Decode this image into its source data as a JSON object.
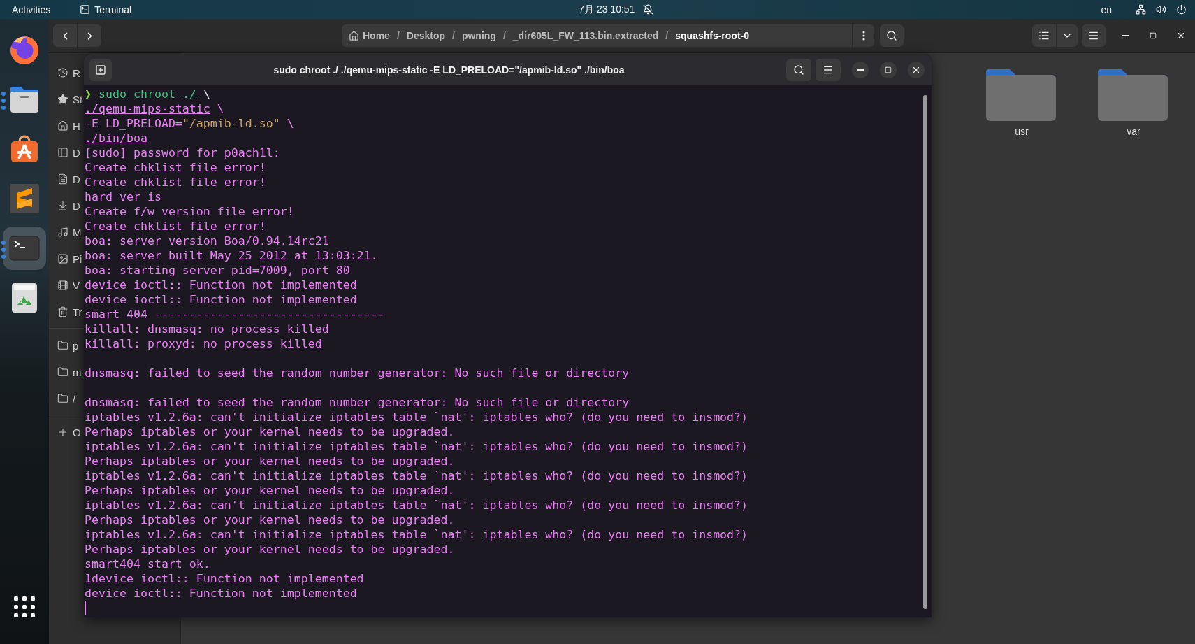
{
  "top_bar": {
    "activities": "Activities",
    "app_menu": "Terminal",
    "clock": "7月 23  10:51",
    "language": "en"
  },
  "dock": [
    {
      "kind": "browser",
      "running": false,
      "active": false
    },
    {
      "kind": "files",
      "running": true,
      "active": false
    },
    {
      "kind": "store",
      "running": false,
      "active": false
    },
    {
      "kind": "editor",
      "running": false,
      "active": false
    },
    {
      "kind": "terminal",
      "running": true,
      "active": true
    },
    {
      "kind": "trash",
      "running": false,
      "active": false
    },
    {
      "kind": "apps",
      "running": false,
      "active": false
    }
  ],
  "files_window": {
    "path_bar": [
      {
        "label": "Home",
        "kind": "home",
        "selected": false
      },
      {
        "label": "Desktop",
        "separator": "/",
        "selected": false
      },
      {
        "label": "pwning",
        "separator": "/",
        "selected": false
      },
      {
        "label": "_dir605L_FW_113.bin.extracted",
        "separator": "/",
        "selected": false
      },
      {
        "label": "squashfs-root-0",
        "separator": "/",
        "selected": true
      }
    ],
    "sidebar_sections": [
      [
        {
          "label": "R",
          "kind": "recent"
        },
        {
          "label": "St",
          "kind": "starred"
        },
        {
          "label": "H",
          "kind": "home"
        },
        {
          "label": "D",
          "kind": "desktop"
        },
        {
          "label": "D",
          "kind": "documents"
        },
        {
          "label": "D",
          "kind": "downloads"
        },
        {
          "label": "M",
          "kind": "music"
        },
        {
          "label": "Pi",
          "kind": "pictures"
        },
        {
          "label": "V",
          "kind": "videos"
        },
        {
          "label": "Tr",
          "kind": "trash"
        }
      ],
      [
        {
          "label": "p",
          "kind": "folder"
        },
        {
          "label": "m",
          "kind": "folder"
        },
        {
          "label": "/",
          "kind": "folder"
        }
      ],
      [
        {
          "label": "O",
          "kind": "add"
        }
      ]
    ],
    "items": [
      {
        "name": "usr",
        "kind": "folder"
      },
      {
        "name": "var",
        "kind": "folder"
      }
    ]
  },
  "terminal": {
    "title": "sudo chroot ./ ./qemu-mips-static -E LD_PRELOAD=\"/apmib-ld.so\" ./bin/boa",
    "cursor": true,
    "lines": [
      {
        "segments": [
          {
            "kind": "prompt",
            "text": "❯ "
          },
          {
            "kind": "command",
            "text": "sudo"
          },
          {
            "kind": "word",
            "text": " chroot "
          },
          {
            "kind": "command",
            "text": "./"
          },
          {
            "kind": "escape",
            "text": " \\"
          }
        ]
      },
      {
        "segments": [
          {
            "kind": "path",
            "text": "./qemu-mips-static"
          },
          {
            "kind": "plain",
            "text": " \\"
          }
        ]
      },
      {
        "segments": [
          {
            "kind": "plain",
            "text": "-E LD_PRELOAD="
          },
          {
            "kind": "string",
            "text": "\"/apmib-ld.so\""
          },
          {
            "kind": "plain",
            "text": " \\"
          }
        ]
      },
      {
        "segments": [
          {
            "kind": "path",
            "text": "./bin/boa"
          }
        ]
      },
      {
        "text": "[sudo] password for p0ach1l:"
      },
      {
        "text": "Create chklist file error!"
      },
      {
        "text": "Create chklist file error!"
      },
      {
        "text": "hard ver is"
      },
      {
        "text": "Create f/w version file error!"
      },
      {
        "text": "Create chklist file error!"
      },
      {
        "text": "boa: server version Boa/0.94.14rc21"
      },
      {
        "text": "boa: server built May 25 2012 at 13:03:21."
      },
      {
        "text": "boa: starting server pid=7009, port 80"
      },
      {
        "text": "device ioctl:: Function not implemented"
      },
      {
        "text": "device ioctl:: Function not implemented"
      },
      {
        "text": "smart 404 ---------------------------------"
      },
      {
        "text": "killall: dnsmasq: no process killed"
      },
      {
        "text": "killall: proxyd: no process killed"
      },
      {
        "text": "dnsmasq: failed to seed the random number generator: No such file or directory",
        "blank_before": true
      },
      {
        "text": "dnsmasq: failed to seed the random number generator: No such file or directory",
        "blank_before": true
      },
      {
        "text": "iptables v1.2.6a: can't initialize iptables table `nat': iptables who? (do you need to insmod?)"
      },
      {
        "text": "Perhaps iptables or your kernel needs to be upgraded."
      },
      {
        "text": "iptables v1.2.6a: can't initialize iptables table `nat': iptables who? (do you need to insmod?)"
      },
      {
        "text": "Perhaps iptables or your kernel needs to be upgraded."
      },
      {
        "text": "iptables v1.2.6a: can't initialize iptables table `nat': iptables who? (do you need to insmod?)"
      },
      {
        "text": "Perhaps iptables or your kernel needs to be upgraded."
      },
      {
        "text": "iptables v1.2.6a: can't initialize iptables table `nat': iptables who? (do you need to insmod?)"
      },
      {
        "text": "Perhaps iptables or your kernel needs to be upgraded."
      },
      {
        "text": "iptables v1.2.6a: can't initialize iptables table `nat': iptables who? (do you need to insmod?)"
      },
      {
        "text": "Perhaps iptables or your kernel needs to be upgraded."
      },
      {
        "text": "smart404 start ok."
      },
      {
        "text": "1device ioctl:: Function not implemented"
      },
      {
        "text": "device ioctl:: Function not implemented"
      }
    ]
  }
}
